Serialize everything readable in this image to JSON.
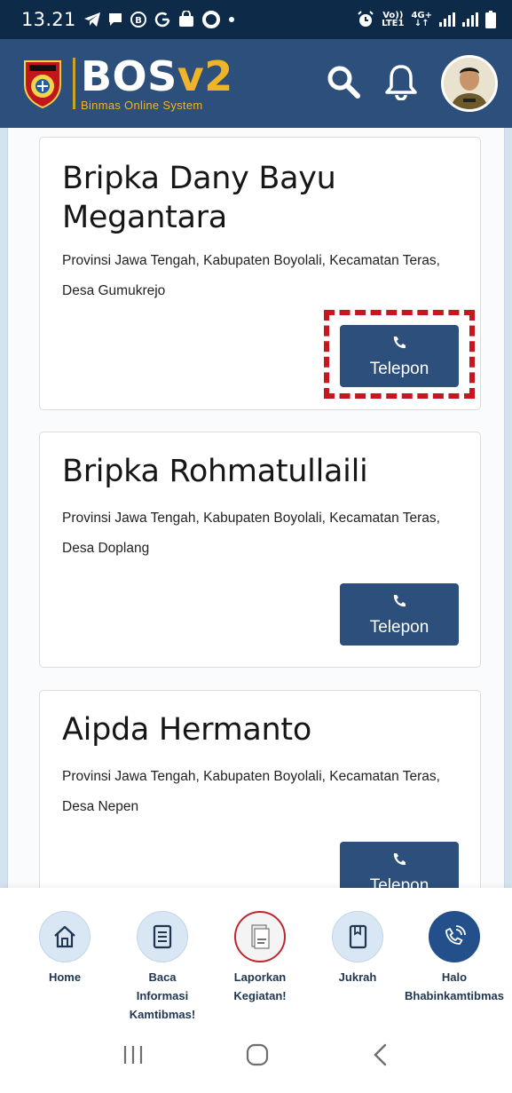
{
  "status_bar": {
    "time": "13.21",
    "network_top": "Vo))",
    "network_bottom": "LTE1",
    "network_gen": "4G+"
  },
  "header": {
    "brand_main": "BOS",
    "brand_version": "v2",
    "brand_subtitle": "Binmas Online System",
    "accent_color": "#f0b429",
    "header_color": "#2c4f7c"
  },
  "officers": [
    {
      "name": "Bripka Dany Bayu Megantara",
      "address": "Provinsi Jawa Tengah, Kabupaten Boyolali, Kecamatan Teras, Desa Gumukrejo",
      "call_label": "Telepon"
    },
    {
      "name": "Bripka Rohmatullaili",
      "address": "Provinsi Jawa Tengah, Kabupaten Boyolali, Kecamatan Teras, Desa Doplang",
      "call_label": "Telepon"
    },
    {
      "name": "Aipda Hermanto",
      "address": "Provinsi Jawa Tengah, Kabupaten Boyolali, Kecamatan Teras, Desa Nepen",
      "call_label": "Telepon"
    }
  ],
  "bottom_nav": [
    {
      "label": "Home",
      "icon": "home-icon"
    },
    {
      "label": "Baca Informasi Kamtibmas!",
      "icon": "document-icon"
    },
    {
      "label": "Laporkan Kegiatan!",
      "icon": "report-icon"
    },
    {
      "label": "Jukrah",
      "icon": "book-icon"
    },
    {
      "label": "Halo Bhabinkamtibmas",
      "icon": "phone-call-icon"
    }
  ],
  "highlight_color": "#c8161e"
}
